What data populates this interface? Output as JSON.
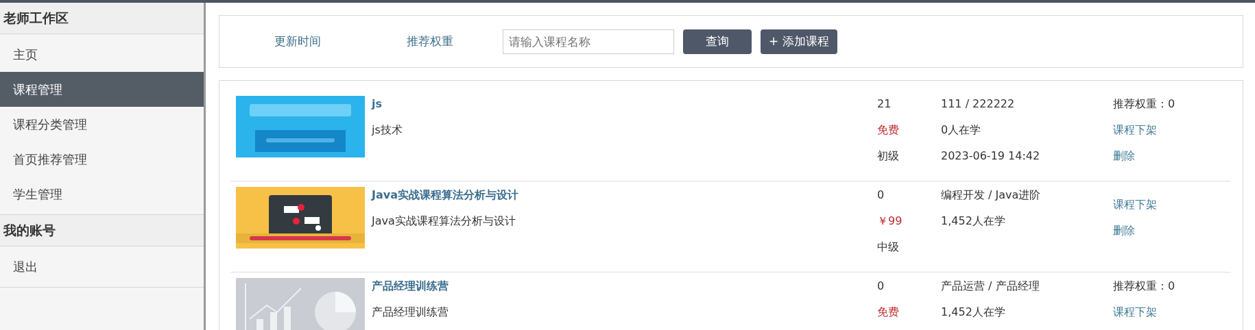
{
  "sidebar": {
    "sections": [
      {
        "title": "老师工作区",
        "items": [
          {
            "label": "主页",
            "selected": false
          },
          {
            "label": "课程管理",
            "selected": true
          },
          {
            "label": "课程分类管理",
            "selected": false
          },
          {
            "label": "首页推荐管理",
            "selected": false
          },
          {
            "label": "学生管理",
            "selected": false
          }
        ]
      },
      {
        "title": "我的账号",
        "items": [
          {
            "label": "退出",
            "selected": false
          }
        ]
      }
    ]
  },
  "toolbar": {
    "sort_links": [
      "更新时间",
      "推荐权重"
    ],
    "search": {
      "placeholder": "请输入课程名称"
    },
    "query_button": "查询",
    "add_button": "+ 添加课程"
  },
  "courses": [
    {
      "kind": "picture",
      "title": "js",
      "description": "js技术",
      "col_1": [
        "21",
        "免费",
        "初级"
      ],
      "col_2": [
        "111 / 222222",
        "0人在学",
        "2023-06-19 14:42"
      ],
      "weight": "推荐权重：0",
      "actions": [
        "课程下架",
        "删除"
      ]
    },
    {
      "kind": "picture",
      "title": "Java实战课程算法分析与设计",
      "description": "Java实战课程算法分析与设计",
      "col_1": [
        "0",
        "￥99",
        "中级"
      ],
      "col_2": [
        "编程开发 / Java进阶",
        "1,452人在学"
      ],
      "actions": [
        "课程下架",
        "删除"
      ]
    },
    {
      "kind": "picture",
      "title": "产品经理训练营",
      "description": "产品经理训练营",
      "col_1": [
        "0",
        "免费"
      ],
      "col_2": [
        "产品运营 / 产品经理",
        "1,452人在学"
      ],
      "weight": "推荐权重：0",
      "actions": [
        "课程下架"
      ]
    }
  ]
}
